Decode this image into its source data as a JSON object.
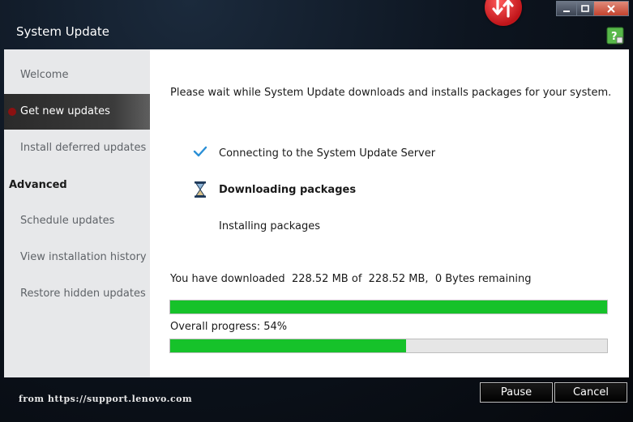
{
  "window": {
    "title": "System Update"
  },
  "sidebar": {
    "items": [
      {
        "label": "Welcome",
        "active": false
      },
      {
        "label": "Get new updates",
        "active": true
      },
      {
        "label": "Install deferred updates",
        "active": false
      }
    ],
    "advanced_heading": "Advanced",
    "advanced_items": [
      {
        "label": "Schedule updates"
      },
      {
        "label": "View installation history"
      },
      {
        "label": "Restore hidden updates"
      }
    ]
  },
  "main": {
    "intro": "Please wait while System Update downloads and installs packages for your system.",
    "steps": [
      {
        "label": "Connecting to the System Update Server",
        "status": "done",
        "icon": "checkmark-icon"
      },
      {
        "label": "Downloading packages",
        "status": "in-progress",
        "icon": "hourglass-icon"
      },
      {
        "label": "Installing packages",
        "status": "pending",
        "icon": ""
      }
    ],
    "download": {
      "prefix": "You have downloaded",
      "downloaded": "228.52 MB",
      "of_label": "of",
      "total": "228.52 MB,",
      "remaining": "0 Bytes remaining",
      "progress": 1.0
    },
    "overall": {
      "label": "Overall progress: 54%",
      "progress": 0.54
    }
  },
  "buttons": {
    "pause": "Pause",
    "cancel": "Cancel"
  },
  "footer": {
    "source_text": "from https://support.lenovo.com"
  },
  "colors": {
    "progress_fill": "#16c22a",
    "active_nav_dot": "#8b1111",
    "accent_check": "#2a8fd6"
  }
}
